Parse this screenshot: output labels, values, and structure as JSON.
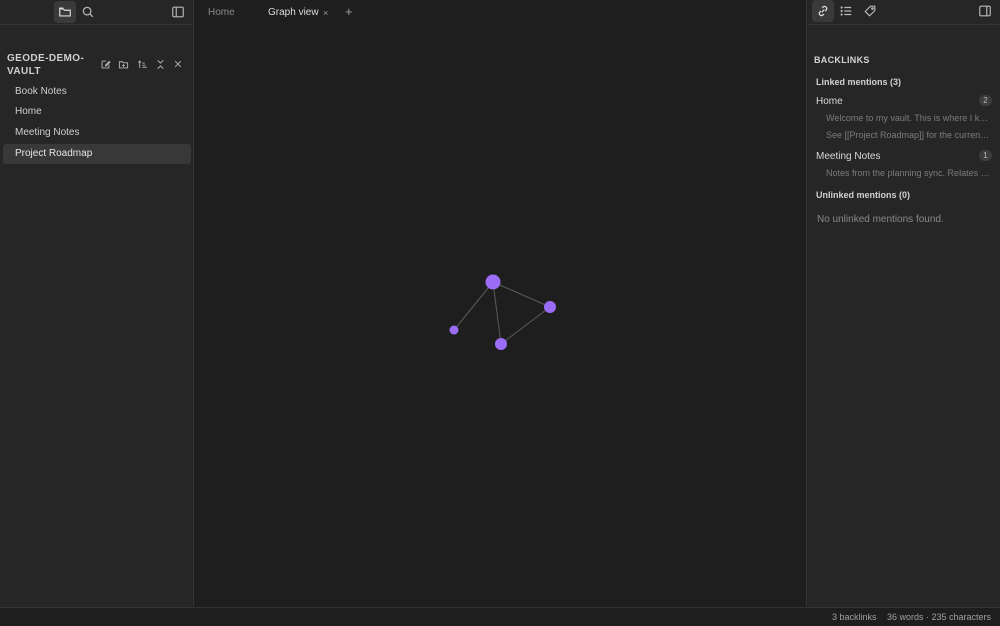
{
  "left_sidebar": {
    "ribbon": [
      {
        "icon": "folder-icon",
        "active": true
      },
      {
        "icon": "search-icon",
        "active": false
      }
    ],
    "toggle_icon": "sidebar-toggle-icon",
    "vault_name": "GEODE-DEMO-VAULT",
    "vault_actions": [
      "new-note-icon",
      "new-folder-icon",
      "sort-icon",
      "collapse-all-icon",
      "close-icon"
    ],
    "files": [
      {
        "label": "Book Notes",
        "active": false
      },
      {
        "label": "Home",
        "active": false
      },
      {
        "label": "Meeting Notes",
        "active": false
      },
      {
        "label": "Project Roadmap",
        "active": true
      }
    ]
  },
  "tabs": [
    {
      "label": "Home",
      "active": false
    },
    {
      "label": "Graph view",
      "active": true,
      "close": "×"
    }
  ],
  "new_tab": "+",
  "graph": {
    "node_color": "#9b6cf5",
    "edge_color": "#5a5a5a",
    "node_count": 4,
    "edge_count": 4
  },
  "right_sidebar": {
    "ribbon": [
      "link-icon",
      "list-icon",
      "tag-icon"
    ],
    "toggle_icon": "sidebar-toggle-icon",
    "title": "BACKLINKS",
    "linked_header": "Linked mentions (3)",
    "linked": [
      {
        "file": "Home",
        "count": "2",
        "snippets": [
          "Welcome to my vault. This is where I ke...",
          "See [[Project Roadmap]] for the current..."
        ]
      },
      {
        "file": "Meeting Notes",
        "count": "1",
        "snippets": [
          "Notes from the planning sync. Relates t..."
        ]
      }
    ],
    "unlinked_header": "Unlinked mentions (0)",
    "unlinked_empty": "No unlinked mentions found."
  },
  "status_bar": {
    "backlinks": "3 backlinks",
    "counts": "36 words · 235 characters"
  }
}
